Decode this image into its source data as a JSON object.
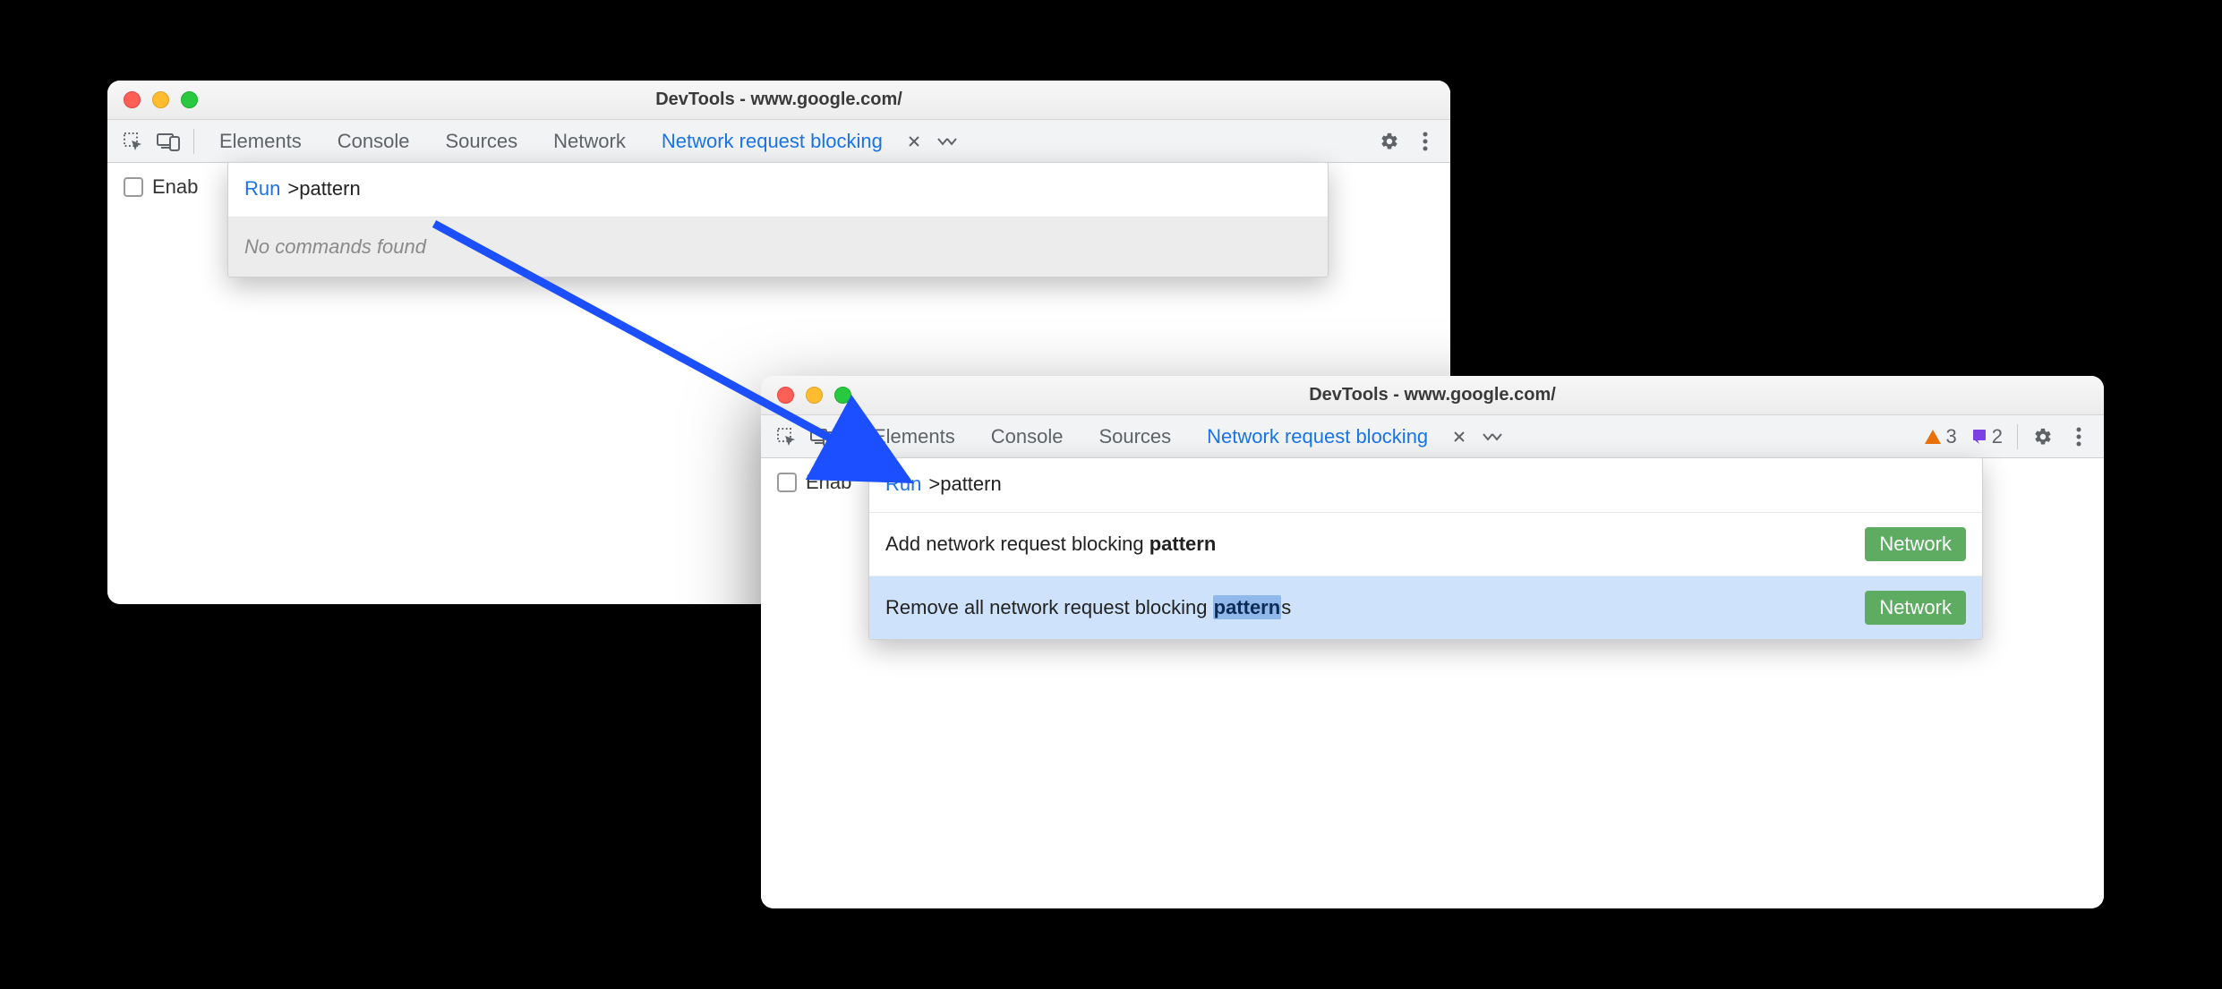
{
  "windows": {
    "a": {
      "title": "DevTools - www.google.com/",
      "tabs": {
        "elements": "Elements",
        "console": "Console",
        "sources": "Sources",
        "network": "Network",
        "blocking": "Network request blocking"
      },
      "enable_label": "Enab",
      "command": {
        "run_label": "Run",
        "caret": ">",
        "query": "pattern",
        "empty": "No commands found"
      }
    },
    "b": {
      "title": "DevTools - www.google.com/",
      "tabs": {
        "elements": "Elements",
        "console": "Console",
        "sources": "Sources",
        "blocking": "Network request blocking"
      },
      "warnings_count": "3",
      "issues_count": "2",
      "enable_label": "Enab",
      "command": {
        "run_label": "Run",
        "caret": ">",
        "query": "pattern",
        "results": [
          {
            "pre": "Add network request blocking ",
            "match": "pattern",
            "post": "",
            "category": "Network"
          },
          {
            "pre": "Remove all network request blocking ",
            "match": "pattern",
            "post": "s",
            "category": "Network"
          }
        ]
      }
    }
  }
}
